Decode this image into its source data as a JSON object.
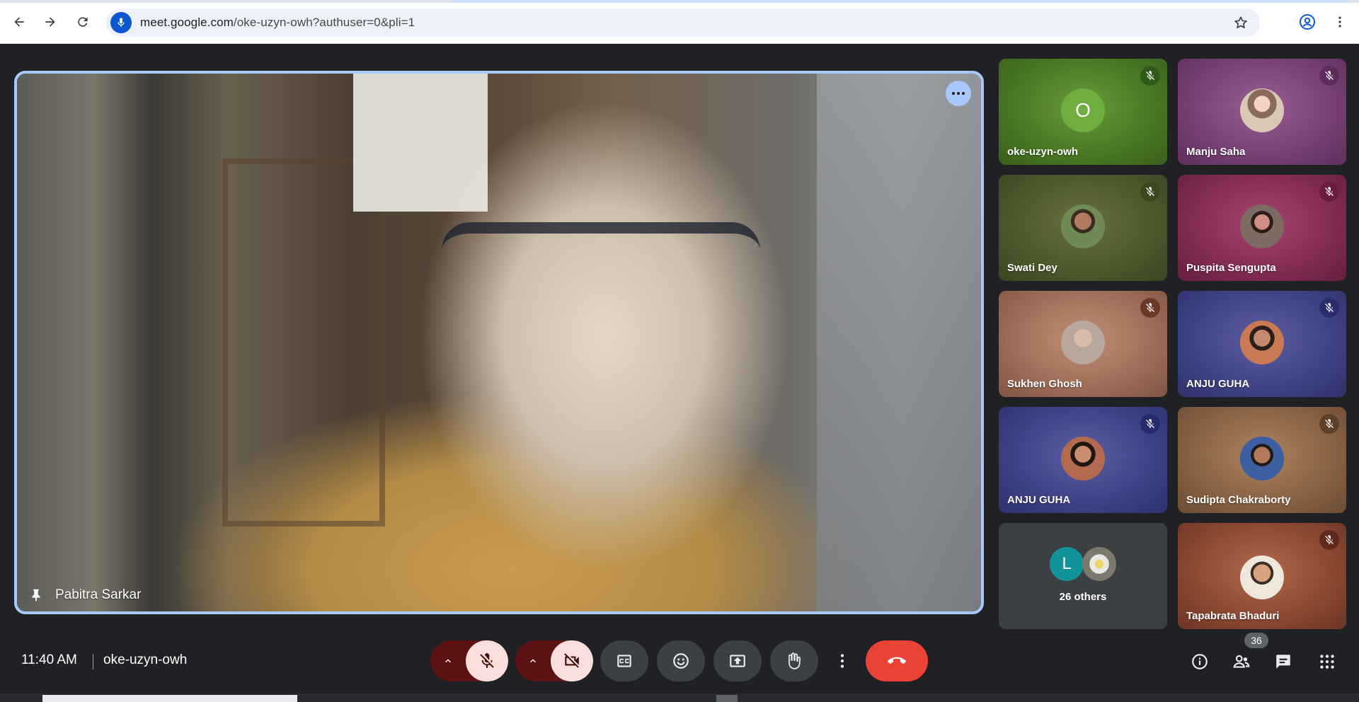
{
  "browser": {
    "url_host": "meet.google.com",
    "url_path": "/oke-uzyn-owh?authuser=0&pli=1"
  },
  "main_tile": {
    "name": "Pabitra Sarkar"
  },
  "participants": [
    {
      "name": "oke-uzyn-owh",
      "initial": "O",
      "muted": true
    },
    {
      "name": "Manju Saha",
      "muted": true
    },
    {
      "name": "Swati Dey",
      "muted": true
    },
    {
      "name": "Puspita Sengupta",
      "muted": true
    },
    {
      "name": "Sukhen Ghosh",
      "muted": true
    },
    {
      "name": "ANJU GUHA",
      "muted": true
    },
    {
      "name": "ANJU GUHA",
      "muted": true
    },
    {
      "name": "Sudipta Chakraborty",
      "muted": true
    },
    {
      "name": "26 others",
      "initial": "L"
    },
    {
      "name": "Tapabrata Bhaduri",
      "muted": true
    }
  ],
  "bottom_bar": {
    "time": "11:40 AM",
    "meeting_code": "oke-uzyn-owh",
    "people_count": "36"
  },
  "colors": {
    "accent": "#a8c7fa",
    "end_call": "#ea4335",
    "muted_pill": "#f9dedc"
  }
}
